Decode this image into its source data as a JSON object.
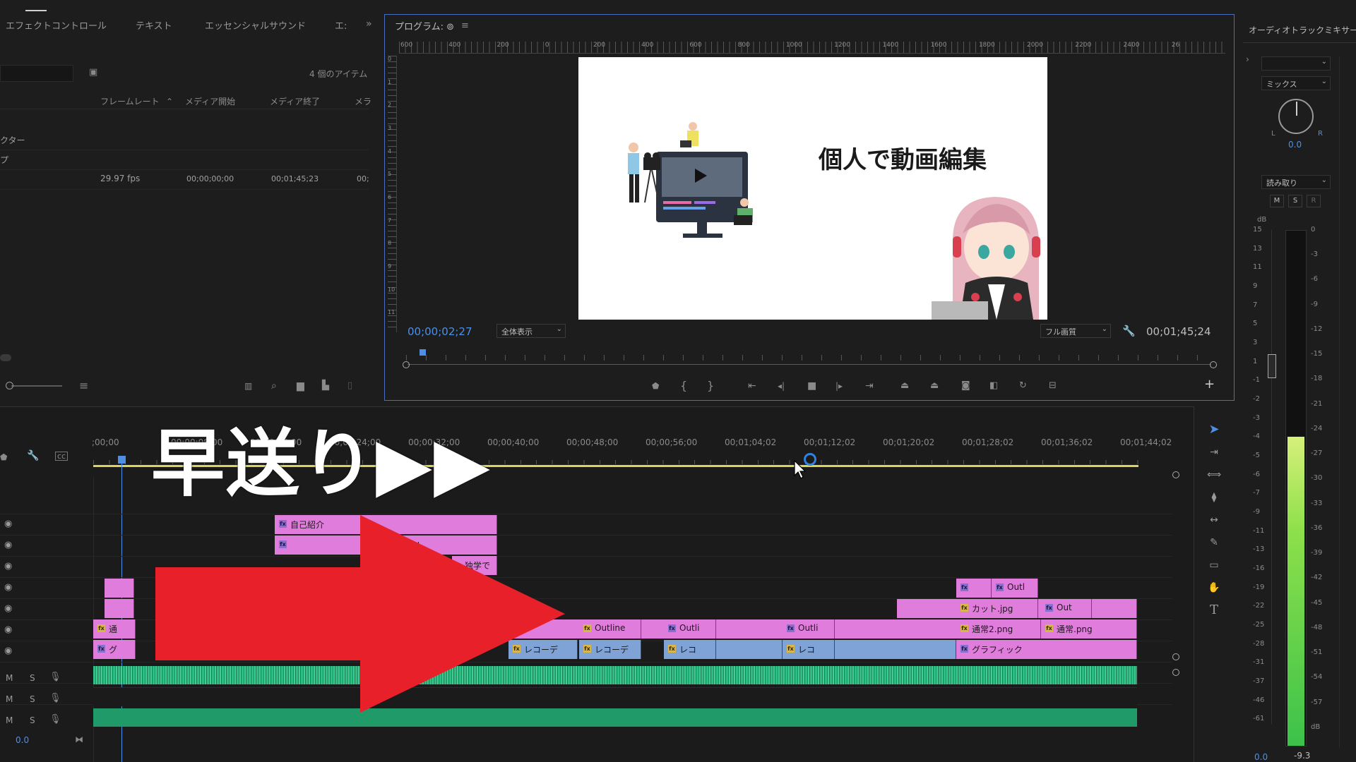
{
  "left_panel": {
    "tabs": [
      "エフェクトコントロール",
      "テキスト",
      "エッセンシャルサウンド",
      "エ:"
    ],
    "item_count": "4 個のアイテム",
    "columns": [
      "フレームレート",
      "メディア開始",
      "メディア終了",
      "メラ"
    ],
    "rows": [
      {
        "name": "クター",
        "fps": "",
        "start": "",
        "end": "",
        "extra": ""
      },
      {
        "name": "プ",
        "fps": "",
        "start": "",
        "end": "",
        "extra": ""
      },
      {
        "name": "",
        "fps": "29.97 fps",
        "start": "00;00;00;00",
        "end": "00;01;45;23",
        "extra": "00;"
      }
    ]
  },
  "program_monitor": {
    "title": "プログラム: ⊚",
    "ruler_labels": [
      "600",
      "400",
      "200",
      "0",
      "200",
      "400",
      "600",
      "800",
      "1000",
      "1200",
      "1400",
      "1600",
      "1800",
      "2000",
      "2200",
      "2400",
      "26"
    ],
    "vruler_labels": [
      "0",
      "1",
      "2",
      "3",
      "4",
      "5",
      "6",
      "7",
      "8",
      "9",
      "10",
      "11"
    ],
    "video_title": "個人で動画編集",
    "current_time": "00;00;02;27",
    "zoom": "全体表示",
    "quality": "フル画質",
    "duration": "00;01;45;24"
  },
  "audio_mixer": {
    "title": "オーディオトラックミキサー",
    "mix_label": "ミックス",
    "pan_value": "0.0",
    "read_mode": "読み取り",
    "buttons": [
      "M",
      "S",
      "R"
    ],
    "db_label": "dB",
    "left_scale": [
      "15",
      "13",
      "11",
      "9",
      "7",
      "5",
      "3",
      "1",
      "-1",
      "-2",
      "-3",
      "-4",
      "-5",
      "-6",
      "-7",
      "-9",
      "-11",
      "-13",
      "-16",
      "-19",
      "-22",
      "-25",
      "-28",
      "-31",
      "-37",
      "-46",
      "-61"
    ],
    "right_scale": [
      "0",
      "-3",
      "-6",
      "-9",
      "-12",
      "-15",
      "-18",
      "-21",
      "-24",
      "-27",
      "-30",
      "-33",
      "-36",
      "-39",
      "-42",
      "-45",
      "-48",
      "-51",
      "-54",
      "-57",
      "dB"
    ],
    "volume": "0.0",
    "peak": "-9.3",
    "level": 0.6
  },
  "timeline": {
    "overlay_text": "早送り▶▶",
    "time_labels": [
      ";00;00",
      "00;00;08;00",
      "00;00;16;00",
      "00;00;24;00",
      "00;00;32;00",
      "00;00;40;00",
      "00;00;48;00",
      "00;00;56;00",
      "00;01;04;02",
      "00;01;12;02",
      "00;01;20;02",
      "00;01;28;02",
      "00;01;36;02",
      "00;01;44;02"
    ],
    "audio_volume": "0.0",
    "clip_labels": {
      "intro": "自己紹介",
      "ou": "Ou",
      "gakushu": "・独学で",
      "outline_small": "Outl",
      "cut": "カット.jpg",
      "out": "Out",
      "outline": "Outline",
      "outli": "Outli",
      "normal2": "通常2.png",
      "normal": "通常.png",
      "tsu": "通",
      "recorder": "レコーデ",
      "reco": "レコ",
      "graphic": "グラフィック",
      "gu": "グ"
    }
  }
}
